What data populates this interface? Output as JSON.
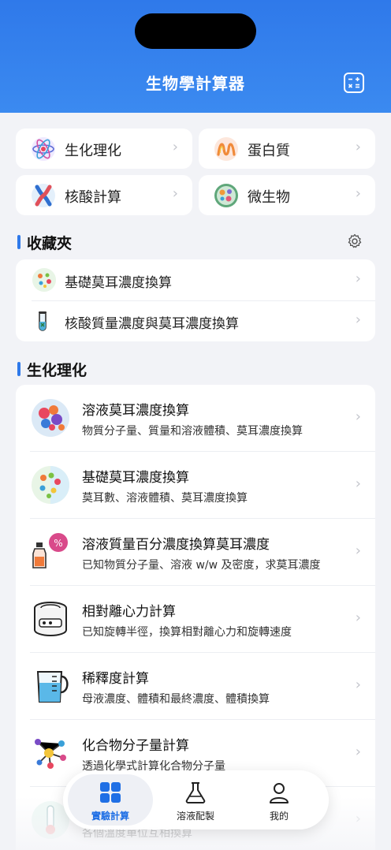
{
  "app": {
    "title": "生物學計算器"
  },
  "categories": [
    {
      "label": "生化理化",
      "icon": "atom-icon"
    },
    {
      "label": "蛋白質",
      "icon": "protein-icon"
    },
    {
      "label": "核酸計算",
      "icon": "chromosome-icon"
    },
    {
      "label": "微生物",
      "icon": "microbe-icon"
    }
  ],
  "favorites": {
    "title": "收藏夾",
    "items": [
      {
        "label": "基礎莫耳濃度換算",
        "icon": "molecules-icon"
      },
      {
        "label": "核酸質量濃度與莫耳濃度換算",
        "icon": "test-tube-icon"
      }
    ]
  },
  "biochem": {
    "title": "生化理化",
    "items": [
      {
        "title": "溶液莫耳濃度換算",
        "subtitle": "物質分子量、質量和溶液體積、莫耳濃度換算",
        "icon": "molecule-model-icon"
      },
      {
        "title": "基礎莫耳濃度換算",
        "subtitle": "莫耳數、溶液體積、莫耳濃度換算",
        "icon": "molecules-icon"
      },
      {
        "title": "溶液質量百分濃度換算莫耳濃度",
        "subtitle": "已知物質分子量、溶液 w/w 及密度，求莫耳濃度",
        "icon": "percent-bottle-icon"
      },
      {
        "title": "相對離心力計算",
        "subtitle": "已知旋轉半徑，換算相對離心力和旋轉速度",
        "icon": "centrifuge-icon"
      },
      {
        "title": "稀釋度計算",
        "subtitle": "母液濃度、體積和最終濃度、體積換算",
        "icon": "measuring-cup-icon"
      },
      {
        "title": "化合物分子量計算",
        "subtitle": "透過化學式計算化合物分子量",
        "icon": "molecular-structure-icon"
      },
      {
        "title": "",
        "subtitle": "各個溫度單位互相換算",
        "icon": "thermometer-icon"
      }
    ]
  },
  "tabs": [
    {
      "label": "實驗計算",
      "icon": "grid-icon",
      "active": true
    },
    {
      "label": "溶液配製",
      "icon": "flask-icon",
      "active": false
    },
    {
      "label": "我的",
      "icon": "person-icon",
      "active": false
    }
  ],
  "colors": {
    "primary": "#2f79ea",
    "background": "#f2f3f7"
  }
}
